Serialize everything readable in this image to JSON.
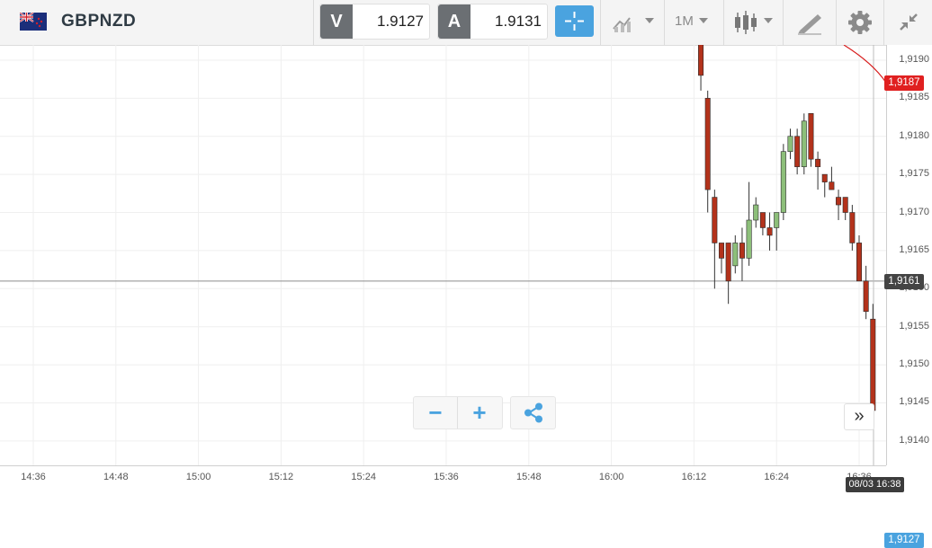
{
  "header": {
    "symbol": "GBPNZD",
    "flag_icon": "uk-nz-flag-icon",
    "sell": {
      "tag": "V",
      "price": "1.9127"
    },
    "buy": {
      "tag": "A",
      "price": "1.9131"
    },
    "timeframe": "1M",
    "icons": [
      "crosshair-icon",
      "chart-type-icon",
      "candlestick-icon",
      "drawing-tool-icon",
      "gear-icon",
      "collapse-icon"
    ]
  },
  "chart_data": {
    "type": "candlestick",
    "x_ticks": [
      "14:36",
      "14:48",
      "15:00",
      "15:12",
      "15:24",
      "15:36",
      "15:48",
      "16:00",
      "16:12",
      "16:24",
      "16:36"
    ],
    "y_ticks": [
      "1,9190",
      "1,9185",
      "1,9180",
      "1,9175",
      "1,9170",
      "1,9165",
      "1,9160",
      "1,9155",
      "1,9150",
      "1,9145",
      "1,9140"
    ],
    "ylim": [
      1.91368,
      1.9192
    ],
    "grid": true,
    "candles": [
      {
        "time": "16:13",
        "open": 1.9194,
        "high": 1.9195,
        "low": 1.9186,
        "close": 1.9188
      },
      {
        "time": "16:14",
        "open": 1.9185,
        "high": 1.9186,
        "low": 1.917,
        "close": 1.9173
      },
      {
        "time": "16:15",
        "open": 1.9172,
        "high": 1.9173,
        "low": 1.916,
        "close": 1.9166
      },
      {
        "time": "16:16",
        "open": 1.9166,
        "high": 1.9165,
        "low": 1.9162,
        "close": 1.9164
      },
      {
        "time": "16:17",
        "open": 1.9166,
        "high": 1.9166,
        "low": 1.9158,
        "close": 1.9161
      },
      {
        "time": "16:18",
        "open": 1.9163,
        "high": 1.9167,
        "low": 1.9162,
        "close": 1.9166
      },
      {
        "time": "16:19",
        "open": 1.9166,
        "high": 1.9168,
        "low": 1.9161,
        "close": 1.9164
      },
      {
        "time": "16:20",
        "open": 1.9164,
        "high": 1.9174,
        "low": 1.9163,
        "close": 1.9169
      },
      {
        "time": "16:21",
        "open": 1.9169,
        "high": 1.9172,
        "low": 1.9168,
        "close": 1.9171
      },
      {
        "time": "16:22",
        "open": 1.917,
        "high": 1.917,
        "low": 1.9167,
        "close": 1.9168
      },
      {
        "time": "16:23",
        "open": 1.9168,
        "high": 1.917,
        "low": 1.9165,
        "close": 1.9167
      },
      {
        "time": "16:24",
        "open": 1.9168,
        "high": 1.917,
        "low": 1.9165,
        "close": 1.917
      },
      {
        "time": "16:25",
        "open": 1.917,
        "high": 1.9179,
        "low": 1.9169,
        "close": 1.9178
      },
      {
        "time": "16:26",
        "open": 1.9178,
        "high": 1.9181,
        "low": 1.9177,
        "close": 1.918
      },
      {
        "time": "16:27",
        "open": 1.918,
        "high": 1.9181,
        "low": 1.9175,
        "close": 1.9176
      },
      {
        "time": "16:28",
        "open": 1.9176,
        "high": 1.9183,
        "low": 1.9175,
        "close": 1.9182
      },
      {
        "time": "16:29",
        "open": 1.9183,
        "high": 1.9183,
        "low": 1.9176,
        "close": 1.9177
      },
      {
        "time": "16:30",
        "open": 1.9177,
        "high": 1.9178,
        "low": 1.9173,
        "close": 1.9176
      },
      {
        "time": "16:31",
        "open": 1.9175,
        "high": 1.9175,
        "low": 1.9172,
        "close": 1.9174
      },
      {
        "time": "16:32",
        "open": 1.9174,
        "high": 1.9176,
        "low": 1.9173,
        "close": 1.9173
      },
      {
        "time": "16:33",
        "open": 1.9172,
        "high": 1.9173,
        "low": 1.9169,
        "close": 1.9171
      },
      {
        "time": "16:34",
        "open": 1.9172,
        "high": 1.9172,
        "low": 1.9169,
        "close": 1.917
      },
      {
        "time": "16:35",
        "open": 1.917,
        "high": 1.9171,
        "low": 1.9165,
        "close": 1.9166
      },
      {
        "time": "16:36",
        "open": 1.9166,
        "high": 1.9167,
        "low": 1.9162,
        "close": 1.9161
      },
      {
        "time": "16:37",
        "open": 1.9161,
        "high": 1.9163,
        "low": 1.9156,
        "close": 1.9157
      },
      {
        "time": "16:38",
        "open": 1.9156,
        "high": 1.9158,
        "low": 1.9143,
        "close": 1.9144
      }
    ],
    "price_levels": [
      {
        "value": "1,9187",
        "color": "#e02020"
      },
      {
        "value": "1,9161",
        "color": "#444444"
      },
      {
        "value": "1,9127",
        "color": "#4aa3df"
      }
    ],
    "current_time": "08/03 16:38",
    "colors": {
      "up": "#8dbf7a",
      "down": "#b3321b",
      "wick": "#333333"
    }
  },
  "controls": {
    "zoom_out": "−",
    "zoom_in": "+",
    "share_icon": "share-icon",
    "scroll_label": "»"
  }
}
